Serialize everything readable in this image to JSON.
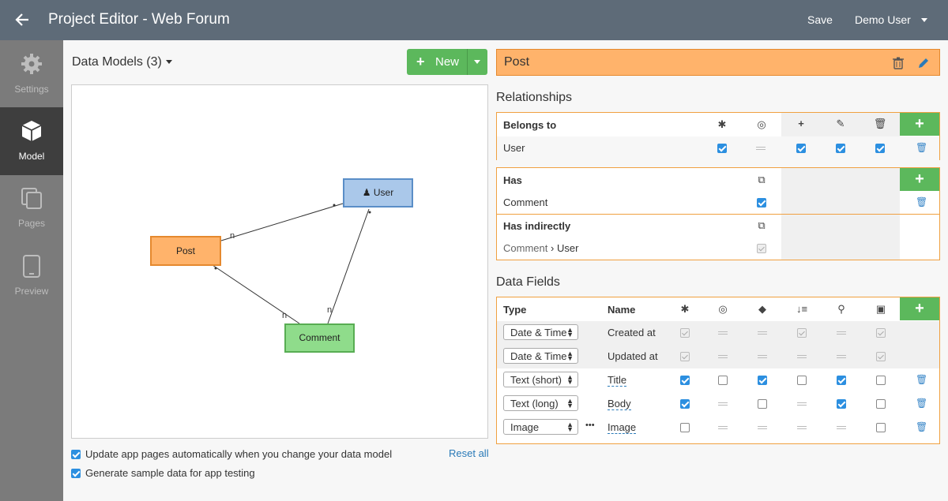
{
  "app": {
    "title": "Project Editor - Web Forum",
    "save_label": "Save",
    "user_label": "Demo User"
  },
  "sidebar": {
    "items": [
      {
        "label": "Settings",
        "icon": "gear-icon",
        "active": false
      },
      {
        "label": "Model",
        "icon": "cube-icon",
        "active": true
      },
      {
        "label": "Pages",
        "icon": "pages-icon",
        "active": false
      },
      {
        "label": "Preview",
        "icon": "tablet-icon",
        "active": false
      }
    ]
  },
  "models": {
    "header": "Data Models (3)",
    "new_label": "New",
    "nodes": {
      "user": "User",
      "post": "Post",
      "comment": "Comment"
    },
    "link_labels": {
      "post_user_n": "n",
      "comment_post_n": "n",
      "comment_user_n": "n"
    },
    "options": [
      {
        "label": "Update app pages automatically when you change your data model",
        "checked": true
      },
      {
        "label": "Generate sample data for app testing",
        "checked": true
      }
    ],
    "reset_label": "Reset all"
  },
  "detail": {
    "model_name": "Post",
    "relationships_title": "Relationships",
    "belongs_to": {
      "header": "Belongs to",
      "rows": [
        {
          "name": "User"
        }
      ]
    },
    "has": {
      "header": "Has",
      "rows": [
        {
          "name": "Comment"
        }
      ]
    },
    "has_indirectly": {
      "header": "Has indirectly",
      "rows": [
        {
          "from": "Comment",
          "sep": "›",
          "to": "User"
        }
      ]
    },
    "data_fields_title": "Data Fields",
    "fields_header": {
      "type": "Type",
      "name": "Name"
    },
    "fields": [
      {
        "type": "Date & Time",
        "name": "Created at",
        "editable": false
      },
      {
        "type": "Date & Time",
        "name": "Updated at",
        "editable": false
      },
      {
        "type": "Text (short)",
        "name": "Title",
        "editable": true
      },
      {
        "type": "Text (long)",
        "name": "Body",
        "editable": true
      },
      {
        "type": "Image",
        "name": "Image",
        "editable": true,
        "more": "•••"
      }
    ]
  },
  "colors": {
    "topbar": "#5e6b78",
    "accent_green": "#5cb85c",
    "post_orange": "#ffb36b",
    "user_blue": "#aac8ea",
    "comment_green": "#8fdc8b",
    "checkbox_blue": "#2c8fe0"
  }
}
